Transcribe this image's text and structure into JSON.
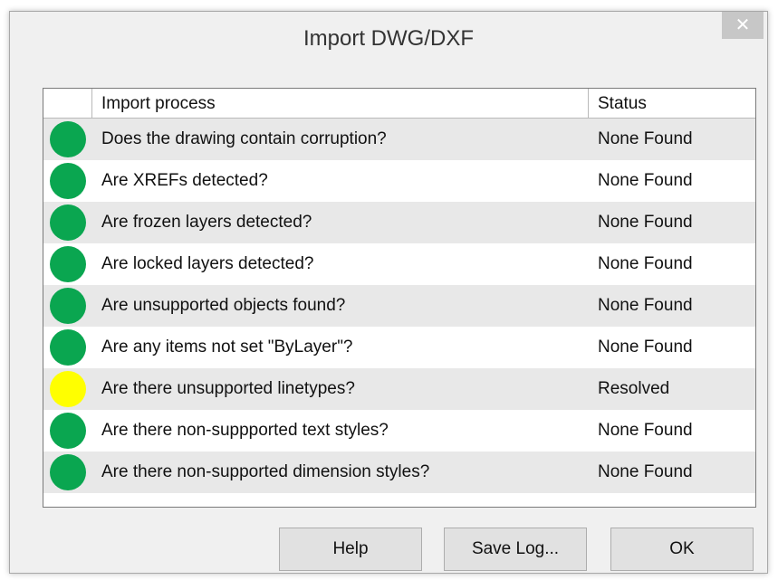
{
  "window": {
    "title": "Import DWG/DXF",
    "close_label": "✕"
  },
  "table": {
    "columns": [
      "",
      "Import process",
      "Status"
    ],
    "rows": [
      {
        "question": "Does the drawing contain corruption?",
        "status": "None Found",
        "indicator": "#0aa650"
      },
      {
        "question": "Are XREFs detected?",
        "status": "None Found",
        "indicator": "#0aa650"
      },
      {
        "question": "Are frozen layers detected?",
        "status": "None Found",
        "indicator": "#0aa650"
      },
      {
        "question": "Are locked layers detected?",
        "status": "None Found",
        "indicator": "#0aa650"
      },
      {
        "question": "Are unsupported objects found?",
        "status": "None Found",
        "indicator": "#0aa650"
      },
      {
        "question": "Are any items not set \"ByLayer\"?",
        "status": "None Found",
        "indicator": "#0aa650"
      },
      {
        "question": "Are there unsupported linetypes?",
        "status": "Resolved",
        "indicator": "#ffff00"
      },
      {
        "question": "Are there non-suppported text styles?",
        "status": "None Found",
        "indicator": "#0aa650"
      },
      {
        "question": "Are there non-supported dimension styles?",
        "status": "None Found",
        "indicator": "#0aa650"
      }
    ]
  },
  "buttons": {
    "help": "Help",
    "save_log": "Save Log...",
    "ok": "OK"
  }
}
